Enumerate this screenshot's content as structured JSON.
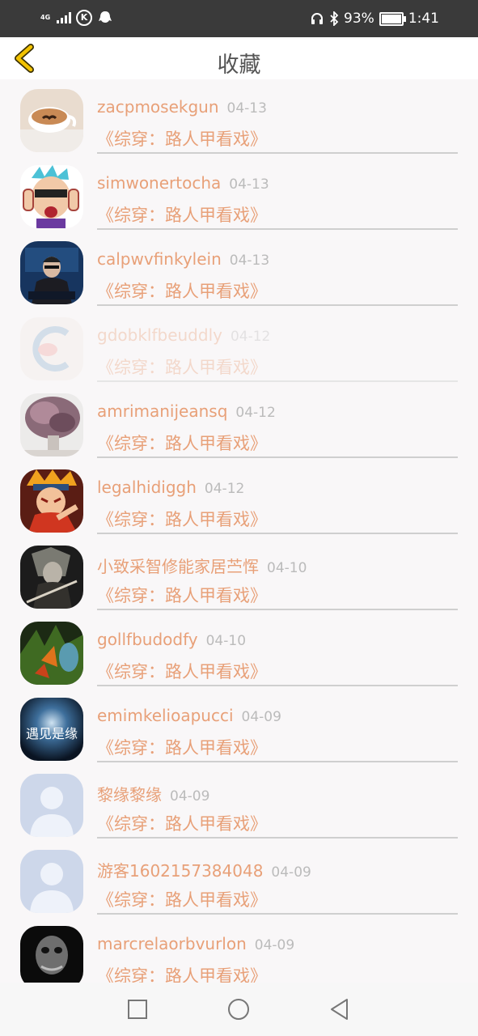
{
  "status_bar": {
    "network": "4G",
    "battery": "93%",
    "battery_level": 0.93,
    "time": "1:41"
  },
  "header": {
    "title": "收藏"
  },
  "items": [
    {
      "name": "zacpmosekgun",
      "date": "04-13",
      "book": "《综穿：路人甲看戏》"
    },
    {
      "name": "simwonertocha",
      "date": "04-13",
      "book": "《综穿：路人甲看戏》"
    },
    {
      "name": "calpwvfinkylein",
      "date": "04-13",
      "book": "《综穿：路人甲看戏》"
    },
    {
      "name": "gdobklfbeuddly",
      "date": "04-12",
      "book": "《综穿：路人甲看戏》"
    },
    {
      "name": "amrimanijeansq",
      "date": "04-12",
      "book": "《综穿：路人甲看戏》"
    },
    {
      "name": "legalhidiggh",
      "date": "04-12",
      "book": "《综穿：路人甲看戏》"
    },
    {
      "name": "小致采智修能家居苎恽",
      "date": "04-10",
      "book": "《综穿：路人甲看戏》"
    },
    {
      "name": "gollfbudodfy",
      "date": "04-10",
      "book": "《综穿：路人甲看戏》"
    },
    {
      "name": "emimkelioapucci",
      "date": "04-09",
      "book": "《综穿：路人甲看戏》"
    },
    {
      "name": "黎缘黎缘",
      "date": "04-09",
      "book": "《综穿：路人甲看戏》"
    },
    {
      "name": "游客1602157384048",
      "date": "04-09",
      "book": "《综穿：路人甲看戏》"
    },
    {
      "name": "marcrelaorbvurlon",
      "date": "04-09",
      "book": "《综穿：路人甲看戏》"
    }
  ],
  "avatar_texts": {
    "item_8": "遇见是缘"
  },
  "colors": {
    "accent": "#e8a078",
    "back_arrow": "#e6b800",
    "status_bar": "#3a3a3a"
  }
}
